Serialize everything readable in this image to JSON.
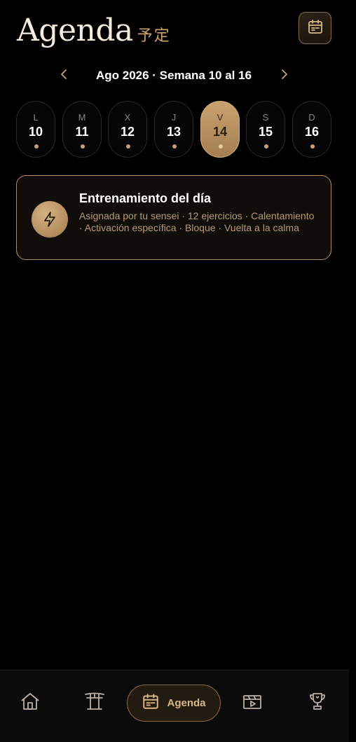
{
  "header": {
    "title": "Agenda",
    "subtitle": "予定",
    "calendar_icon": "calendar-icon"
  },
  "week_nav": {
    "label": "Ago 2026 · Semana 10 al 16",
    "prev_icon": "chevron-left-icon",
    "next_icon": "chevron-right-icon"
  },
  "days": [
    {
      "letter": "L",
      "number": "10",
      "selected": false
    },
    {
      "letter": "M",
      "number": "11",
      "selected": false
    },
    {
      "letter": "X",
      "number": "12",
      "selected": false
    },
    {
      "letter": "J",
      "number": "13",
      "selected": false
    },
    {
      "letter": "V",
      "number": "14",
      "selected": true
    },
    {
      "letter": "S",
      "number": "15",
      "selected": false
    },
    {
      "letter": "D",
      "number": "16",
      "selected": false
    }
  ],
  "workout_card": {
    "title": "Entrenamiento del día",
    "description": "Asignada por tu sensei · 12 ejercicios · Calentamiento · Activación específica · Bloque · Vuelta a la calma",
    "icon": "lightning-icon"
  },
  "bottom_nav": {
    "items": [
      {
        "icon": "home-icon",
        "label": ""
      },
      {
        "icon": "torii-icon",
        "label": ""
      },
      {
        "icon": "calendar-icon",
        "label": "Agenda",
        "active": true
      },
      {
        "icon": "video-icon",
        "label": ""
      },
      {
        "icon": "trophy-icon",
        "label": ""
      }
    ]
  },
  "colors": {
    "accent": "#c9a26e",
    "background": "#000000",
    "card_background": "#100d0a",
    "border": "#b38d5b"
  }
}
